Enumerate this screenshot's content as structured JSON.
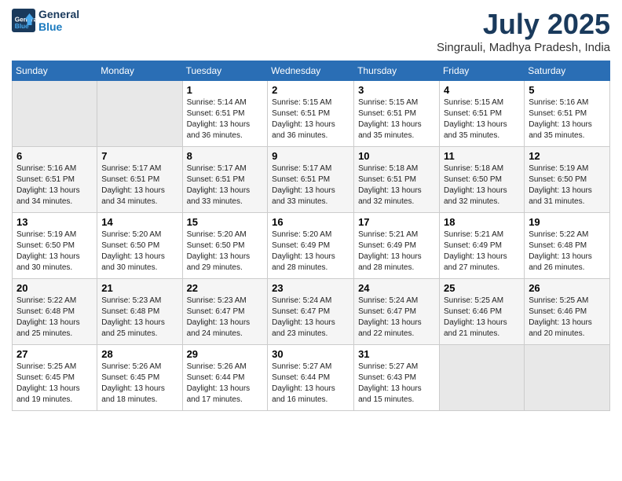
{
  "logo": {
    "line1": "General",
    "line2": "Blue"
  },
  "title": "July 2025",
  "location": "Singrauli, Madhya Pradesh, India",
  "weekdays": [
    "Sunday",
    "Monday",
    "Tuesday",
    "Wednesday",
    "Thursday",
    "Friday",
    "Saturday"
  ],
  "weeks": [
    [
      {
        "day": "",
        "info": ""
      },
      {
        "day": "",
        "info": ""
      },
      {
        "day": "1",
        "info": "Sunrise: 5:14 AM\nSunset: 6:51 PM\nDaylight: 13 hours and 36 minutes."
      },
      {
        "day": "2",
        "info": "Sunrise: 5:15 AM\nSunset: 6:51 PM\nDaylight: 13 hours and 36 minutes."
      },
      {
        "day": "3",
        "info": "Sunrise: 5:15 AM\nSunset: 6:51 PM\nDaylight: 13 hours and 35 minutes."
      },
      {
        "day": "4",
        "info": "Sunrise: 5:15 AM\nSunset: 6:51 PM\nDaylight: 13 hours and 35 minutes."
      },
      {
        "day": "5",
        "info": "Sunrise: 5:16 AM\nSunset: 6:51 PM\nDaylight: 13 hours and 35 minutes."
      }
    ],
    [
      {
        "day": "6",
        "info": "Sunrise: 5:16 AM\nSunset: 6:51 PM\nDaylight: 13 hours and 34 minutes."
      },
      {
        "day": "7",
        "info": "Sunrise: 5:17 AM\nSunset: 6:51 PM\nDaylight: 13 hours and 34 minutes."
      },
      {
        "day": "8",
        "info": "Sunrise: 5:17 AM\nSunset: 6:51 PM\nDaylight: 13 hours and 33 minutes."
      },
      {
        "day": "9",
        "info": "Sunrise: 5:17 AM\nSunset: 6:51 PM\nDaylight: 13 hours and 33 minutes."
      },
      {
        "day": "10",
        "info": "Sunrise: 5:18 AM\nSunset: 6:51 PM\nDaylight: 13 hours and 32 minutes."
      },
      {
        "day": "11",
        "info": "Sunrise: 5:18 AM\nSunset: 6:50 PM\nDaylight: 13 hours and 32 minutes."
      },
      {
        "day": "12",
        "info": "Sunrise: 5:19 AM\nSunset: 6:50 PM\nDaylight: 13 hours and 31 minutes."
      }
    ],
    [
      {
        "day": "13",
        "info": "Sunrise: 5:19 AM\nSunset: 6:50 PM\nDaylight: 13 hours and 30 minutes."
      },
      {
        "day": "14",
        "info": "Sunrise: 5:20 AM\nSunset: 6:50 PM\nDaylight: 13 hours and 30 minutes."
      },
      {
        "day": "15",
        "info": "Sunrise: 5:20 AM\nSunset: 6:50 PM\nDaylight: 13 hours and 29 minutes."
      },
      {
        "day": "16",
        "info": "Sunrise: 5:20 AM\nSunset: 6:49 PM\nDaylight: 13 hours and 28 minutes."
      },
      {
        "day": "17",
        "info": "Sunrise: 5:21 AM\nSunset: 6:49 PM\nDaylight: 13 hours and 28 minutes."
      },
      {
        "day": "18",
        "info": "Sunrise: 5:21 AM\nSunset: 6:49 PM\nDaylight: 13 hours and 27 minutes."
      },
      {
        "day": "19",
        "info": "Sunrise: 5:22 AM\nSunset: 6:48 PM\nDaylight: 13 hours and 26 minutes."
      }
    ],
    [
      {
        "day": "20",
        "info": "Sunrise: 5:22 AM\nSunset: 6:48 PM\nDaylight: 13 hours and 25 minutes."
      },
      {
        "day": "21",
        "info": "Sunrise: 5:23 AM\nSunset: 6:48 PM\nDaylight: 13 hours and 25 minutes."
      },
      {
        "day": "22",
        "info": "Sunrise: 5:23 AM\nSunset: 6:47 PM\nDaylight: 13 hours and 24 minutes."
      },
      {
        "day": "23",
        "info": "Sunrise: 5:24 AM\nSunset: 6:47 PM\nDaylight: 13 hours and 23 minutes."
      },
      {
        "day": "24",
        "info": "Sunrise: 5:24 AM\nSunset: 6:47 PM\nDaylight: 13 hours and 22 minutes."
      },
      {
        "day": "25",
        "info": "Sunrise: 5:25 AM\nSunset: 6:46 PM\nDaylight: 13 hours and 21 minutes."
      },
      {
        "day": "26",
        "info": "Sunrise: 5:25 AM\nSunset: 6:46 PM\nDaylight: 13 hours and 20 minutes."
      }
    ],
    [
      {
        "day": "27",
        "info": "Sunrise: 5:25 AM\nSunset: 6:45 PM\nDaylight: 13 hours and 19 minutes."
      },
      {
        "day": "28",
        "info": "Sunrise: 5:26 AM\nSunset: 6:45 PM\nDaylight: 13 hours and 18 minutes."
      },
      {
        "day": "29",
        "info": "Sunrise: 5:26 AM\nSunset: 6:44 PM\nDaylight: 13 hours and 17 minutes."
      },
      {
        "day": "30",
        "info": "Sunrise: 5:27 AM\nSunset: 6:44 PM\nDaylight: 13 hours and 16 minutes."
      },
      {
        "day": "31",
        "info": "Sunrise: 5:27 AM\nSunset: 6:43 PM\nDaylight: 13 hours and 15 minutes."
      },
      {
        "day": "",
        "info": ""
      },
      {
        "day": "",
        "info": ""
      }
    ]
  ]
}
